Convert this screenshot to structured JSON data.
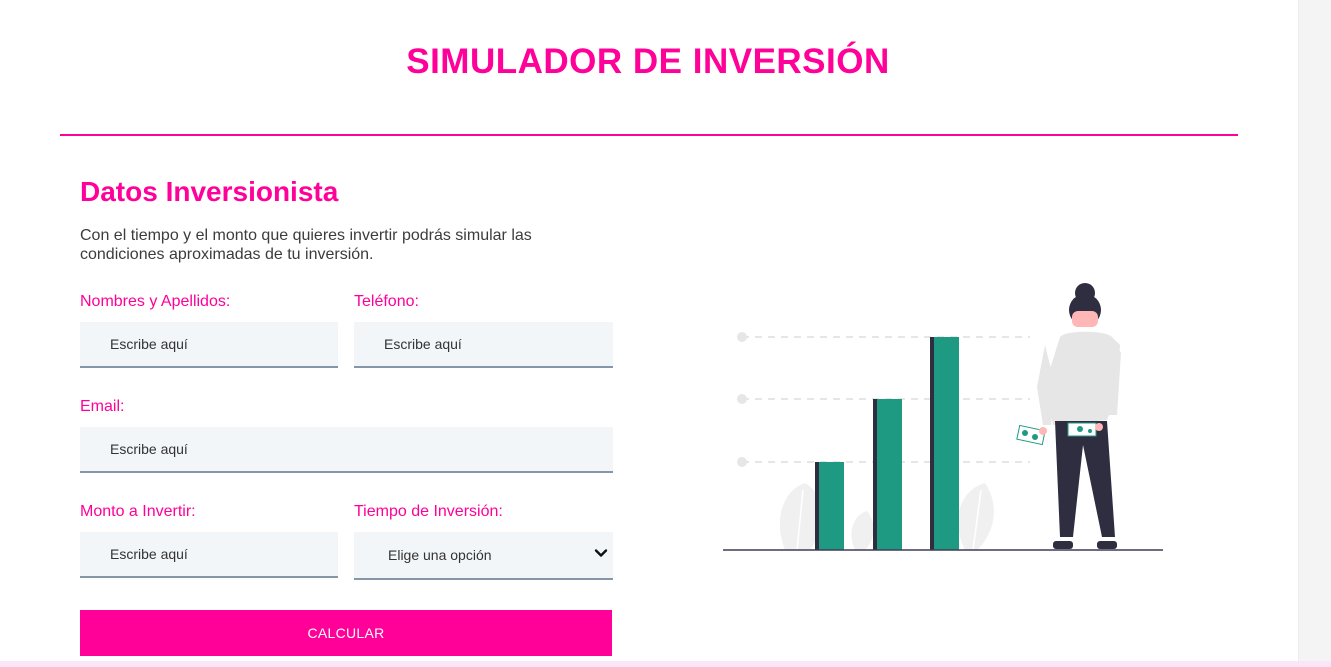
{
  "header": {
    "title": "SIMULADOR DE INVERSIÓN"
  },
  "form": {
    "section_title": "Datos Inversionista",
    "description": "Con el tiempo y el monto que quieres invertir podrás simular las condiciones aproximadas de tu inversión.",
    "fields": {
      "names": {
        "label": "Nombres y Apellidos:",
        "placeholder": "Escribe aquí",
        "value": ""
      },
      "phone": {
        "label": "Teléfono:",
        "placeholder": "Escribe aquí",
        "value": ""
      },
      "email": {
        "label": "Email:",
        "placeholder": "Escribe aquí",
        "value": ""
      },
      "amount": {
        "label": "Monto a Invertir:",
        "placeholder": "Escribe aquí",
        "value": ""
      },
      "term": {
        "label": "Tiempo de Inversión:",
        "selected": "Elige una opción"
      }
    },
    "submit_label": "CALCULAR"
  },
  "colors": {
    "accent": "#ff0099",
    "input_bg": "#f3f6f9",
    "input_border": "#8596a8",
    "bar_green": "#1f9a82",
    "bar_shadow": "#2f2e41"
  },
  "icons": {
    "illustration": "woman-with-money-and-growth-bars",
    "select_arrow": "chevron-down-icon"
  }
}
